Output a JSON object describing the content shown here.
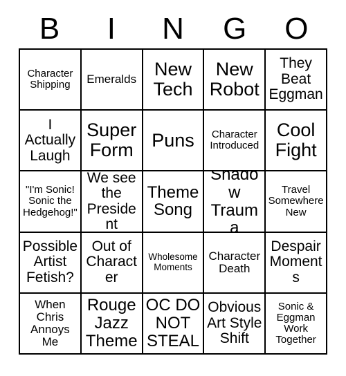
{
  "card": {
    "header_letters": [
      "B",
      "I",
      "N",
      "G",
      "O"
    ],
    "grid_color": "#000000",
    "text_color": "#000000",
    "background_color": "#ffffff",
    "rows": 5,
    "columns": 5,
    "cells": [
      {
        "text": "Character Shipping",
        "size": "xs"
      },
      {
        "text": "Emeralds",
        "size": "sm"
      },
      {
        "text": "New Tech",
        "size": "xl"
      },
      {
        "text": "New Robot",
        "size": "xl"
      },
      {
        "text": "They Beat Eggman",
        "size": "md"
      },
      {
        "text": "I Actually Laugh",
        "size": "md"
      },
      {
        "text": "Super Form",
        "size": "xl"
      },
      {
        "text": "Puns",
        "size": "xl"
      },
      {
        "text": "Character Introduced",
        "size": "xs"
      },
      {
        "text": "Cool Fight",
        "size": "xl"
      },
      {
        "text": "\"I'm Sonic! Sonic the Hedgehog!\"",
        "size": "xs"
      },
      {
        "text": "We see the President",
        "size": "md"
      },
      {
        "text": "Theme Song",
        "size": "lg"
      },
      {
        "text": "Shadow Trauma",
        "size": "lg"
      },
      {
        "text": "Travel Somewhere New",
        "size": "xs"
      },
      {
        "text": "Possible Artist Fetish?",
        "size": "md"
      },
      {
        "text": "Out of Character",
        "size": "md"
      },
      {
        "text": "Wholesome Moments",
        "size": "xxs"
      },
      {
        "text": "Character Death",
        "size": "sm"
      },
      {
        "text": "Despair Moments",
        "size": "md"
      },
      {
        "text": "When Chris Annoys Me",
        "size": "sm"
      },
      {
        "text": "Rouge Jazz Theme",
        "size": "lg"
      },
      {
        "text": "OC DO NOT STEAL",
        "size": "lg"
      },
      {
        "text": "Obvious Art Style Shift",
        "size": "md"
      },
      {
        "text": "Sonic & Eggman Work Together",
        "size": "xs"
      }
    ]
  }
}
